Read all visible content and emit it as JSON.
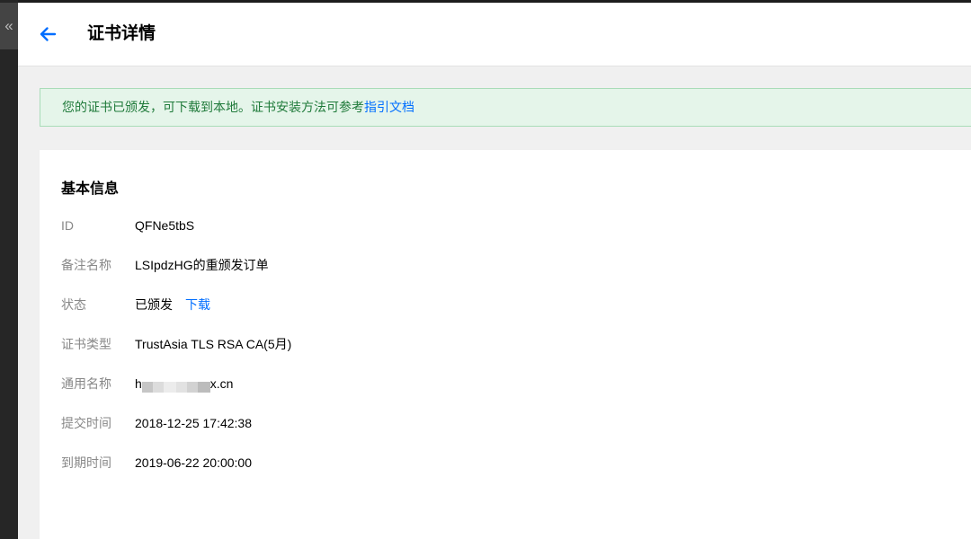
{
  "sidebar": {
    "collapse_label": "«"
  },
  "header": {
    "title": "证书详情"
  },
  "notice": {
    "text": "您的证书已颁发，可下载到本地。证书安装方法可参考",
    "link_label": "指引文档"
  },
  "details": {
    "section_title": "基本信息",
    "rows": [
      {
        "label": "ID",
        "value": "QFNe5tbS"
      },
      {
        "label": "备注名称",
        "value": "LSIpdzHG的重颁发订单"
      },
      {
        "label": "状态",
        "value": "已颁发",
        "link": "下载"
      },
      {
        "label": "证书类型",
        "value": "TrustAsia TLS RSA CA(5月)"
      },
      {
        "label": "通用名称",
        "value_prefix": "h",
        "value_suffix": "x.cn"
      },
      {
        "label": "提交时间",
        "value": "2018-12-25 17:42:38"
      },
      {
        "label": "到期时间",
        "value": "2019-06-22 20:00:00"
      }
    ]
  },
  "colors": {
    "accent": "#006eff",
    "notice_bg": "#e5f5ea",
    "notice_text": "#1f7a3a"
  }
}
